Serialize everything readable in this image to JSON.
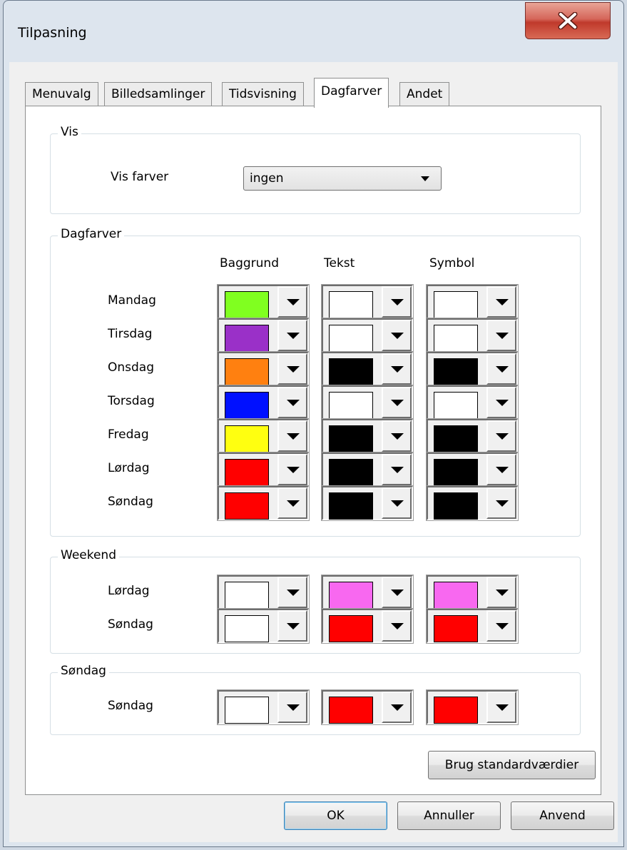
{
  "window": {
    "title": "Tilpasning",
    "close_label": "X"
  },
  "tabs": [
    "Menuvalg",
    "Billedsamlinger",
    "Tidsvisning",
    "Dagfarver",
    "Andet"
  ],
  "active_tab": "Dagfarver",
  "vis_group": {
    "title": "Vis",
    "label": "Vis farver",
    "selected": "ingen"
  },
  "dagfarver_group": {
    "title": "Dagfarver",
    "columns": [
      "Baggrund",
      "Tekst",
      "Symbol"
    ],
    "rows": [
      {
        "day": "Mandag",
        "colors": [
          "#80ff20",
          "#ffffff",
          "#ffffff"
        ]
      },
      {
        "day": "Tirsdag",
        "colors": [
          "#9a30c8",
          "#ffffff",
          "#ffffff"
        ]
      },
      {
        "day": "Onsdag",
        "colors": [
          "#ff8010",
          "#000000",
          "#000000"
        ]
      },
      {
        "day": "Torsdag",
        "colors": [
          "#0010ff",
          "#ffffff",
          "#ffffff"
        ]
      },
      {
        "day": "Fredag",
        "colors": [
          "#ffff10",
          "#000000",
          "#000000"
        ]
      },
      {
        "day": "Lørdag",
        "colors": [
          "#ff0000",
          "#000000",
          "#000000"
        ]
      },
      {
        "day": "Søndag",
        "colors": [
          "#ff0000",
          "#000000",
          "#000000"
        ]
      }
    ]
  },
  "weekend_group": {
    "title": "Weekend",
    "rows": [
      {
        "day": "Lørdag",
        "colors": [
          "#ffffff",
          "#f868f0",
          "#f868f0"
        ]
      },
      {
        "day": "Søndag",
        "colors": [
          "#ffffff",
          "#ff0000",
          "#ff0000"
        ]
      }
    ]
  },
  "sondag_group": {
    "title": "Søndag",
    "rows": [
      {
        "day": "Søndag",
        "colors": [
          "#ffffff",
          "#ff0000",
          "#ff0000"
        ]
      }
    ]
  },
  "buttons": {
    "defaults": "Brug standardværdier",
    "ok": "OK",
    "cancel": "Annuller",
    "apply": "Anvend"
  }
}
